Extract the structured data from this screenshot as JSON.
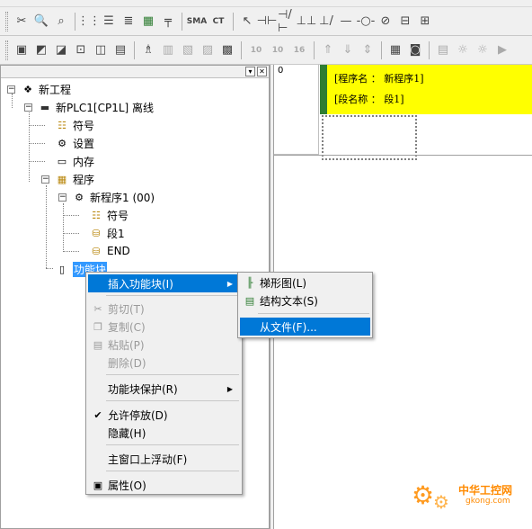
{
  "toolbar_row2": {
    "icons": [
      "cut-icon",
      "zoom-icon",
      "find-icon",
      "grid-icon",
      "watch-icon",
      "list-icon",
      "monitor-icon",
      "tree-icon",
      "sma-icon",
      "ct-icon",
      "select-icon",
      "contact-no-icon",
      "contact-nc-icon",
      "contact-or-icon",
      "contact-or-nc-icon",
      "hline-icon",
      "coil-icon",
      "coil-nc-icon",
      "instruction-icon",
      "block-icon",
      "diff-icon"
    ],
    "text_buttons": {
      "sma": "SMA",
      "ct": "CT"
    }
  },
  "toolbar_row3": {
    "icons": [
      "window-icon",
      "window2-icon",
      "window3-icon",
      "window4-icon",
      "window5-icon",
      "props-icon",
      "cross-ref-icon",
      "io-table-icon",
      "memory-icon",
      "compile-icon",
      "online-icon",
      "transfer-icon",
      "transfer2-icon",
      "transfer3-icon",
      "upload-icon",
      "download-icon",
      "compare-icon",
      "program-icon",
      "mode-icon",
      "debug-icon",
      "step-icon",
      "run-icon"
    ],
    "text_buttons": {
      "b10a": "10",
      "b10b": "10",
      "b16": "16"
    }
  },
  "tree": {
    "project": "新工程",
    "plc": "新PLC1[CP1L] 离线",
    "symbols": "符号",
    "settings": "设置",
    "memory": "内存",
    "programs": "程序",
    "program1": "新程序1 (00)",
    "prog_symbols": "符号",
    "section1": "段1",
    "end": "END",
    "function_blocks": "功能块"
  },
  "editor": {
    "rung_number": "0",
    "program_name_line": "[程序名 ： 新程序1]",
    "section_name_line": "[段名称 ： 段1]"
  },
  "context_menu": {
    "insert_fb": "插入功能块(I)",
    "cut": "剪切(T)",
    "copy": "复制(C)",
    "paste": "粘贴(P)",
    "delete": "删除(D)",
    "fb_protect": "功能块保护(R)",
    "allow_dock": "允许停放(D)",
    "hide": "隐藏(H)",
    "float_main": "主窗口上浮动(F)",
    "properties": "属性(O)"
  },
  "submenu": {
    "ladder": "梯形图(L)",
    "structured_text": "结构文本(S)",
    "from_file": "从文件(F)..."
  },
  "colors": {
    "comment_bg": "#ffff00",
    "rail": "#2e7d32",
    "menu_highlight": "#0078d7",
    "selection": "#3399ff"
  }
}
